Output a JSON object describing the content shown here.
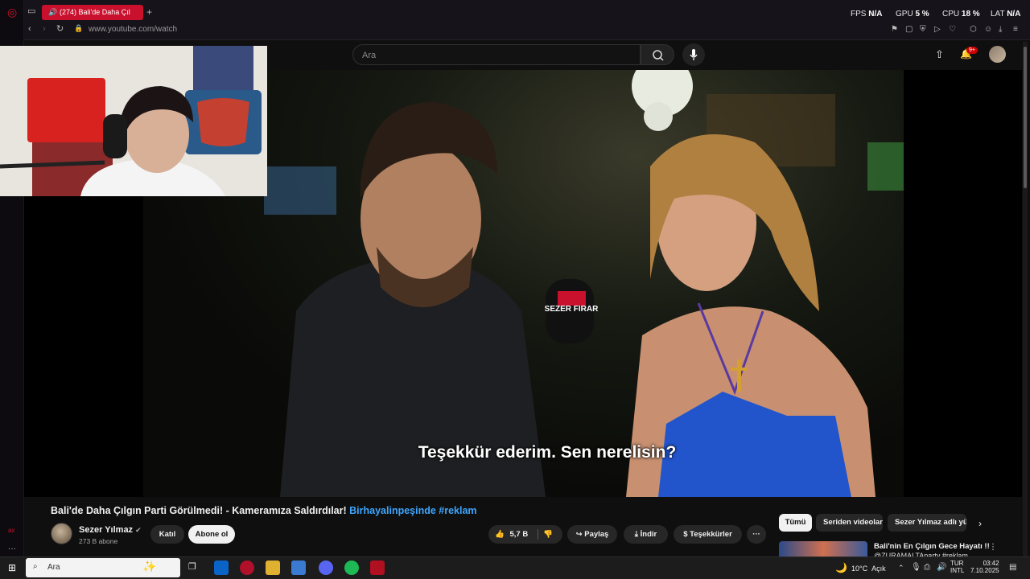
{
  "browser": {
    "tab_title": "(274) Bali'de Daha Çıl",
    "url": "www.youtube.com/watch",
    "perf": {
      "fps_label": "FPS",
      "fps_value": "N/A",
      "gpu_label": "GPU",
      "gpu_value": "5 %",
      "cpu_label": "CPU",
      "cpu_value": "18 %",
      "lat_label": "LAT",
      "lat_value": "N/A"
    }
  },
  "youtube": {
    "search_placeholder": "Ara",
    "notification_count": "9+",
    "subtitle": "Teşekkür ederim. Sen nerelisin?",
    "video_title": "Bali'de Daha Çılgın Parti Görülmedi! - Kameramıza Saldırdılar!",
    "video_title_tags": "Birhayalinpeşinde #reklam",
    "channel_name": "Sezer Yılmaz",
    "subscribers": "273 B abone",
    "join_label": "Katıl",
    "subscribe_label": "Abone ol",
    "like_count": "5,7 B",
    "share_label": "Paylaş",
    "download_label": "İndir",
    "thanks_label": "Teşekkürler",
    "more_label": "···",
    "chips": [
      "Tümü",
      "Seriden videolar",
      "Sezer Yılmaz adlı yük"
    ],
    "rec_title": "Bali'nin En Çılgın Gece Hayatı !!",
    "rec_sub": "@ZURAMALTAparty #reklam"
  },
  "mic_label": "SEZER FIRAR",
  "taskbar": {
    "search_placeholder": "Ara",
    "weather_temp": "10°C",
    "weather_text": "Açık",
    "lang_top": "TUR",
    "lang_bottom": "INTL",
    "time": "03:42",
    "date": "7.10.2025"
  },
  "colors": {
    "accent_red": "#c9102d",
    "link_blue": "#3ea6ff",
    "bg": "#0f0f0f"
  }
}
